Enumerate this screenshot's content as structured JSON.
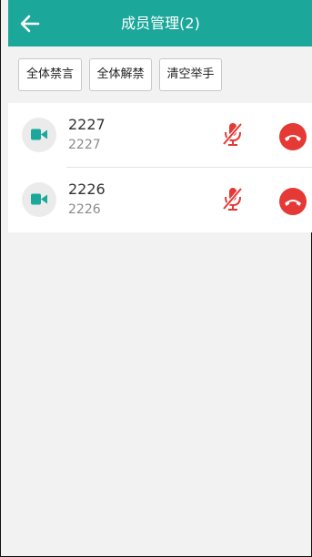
{
  "header": {
    "title": "成员管理(2)",
    "back_icon": "arrow-left-icon"
  },
  "toolbar": {
    "buttons": [
      {
        "label": "全体禁言"
      },
      {
        "label": "全体解禁"
      },
      {
        "label": "清空举手"
      }
    ]
  },
  "members": [
    {
      "name": "2227",
      "number": "2227",
      "avatar_icon": "video-camera-icon",
      "mute_icon": "microphone-muted-icon",
      "hangup_icon": "hang-up-icon"
    },
    {
      "name": "2226",
      "number": "2226",
      "avatar_icon": "video-camera-icon",
      "mute_icon": "microphone-muted-icon",
      "hangup_icon": "hang-up-icon"
    }
  ],
  "colors": {
    "header_bg": "#1ba79a",
    "accent_red": "#e53935",
    "camera_teal": "#1ba79a",
    "page_bg": "#f2f2f2"
  }
}
